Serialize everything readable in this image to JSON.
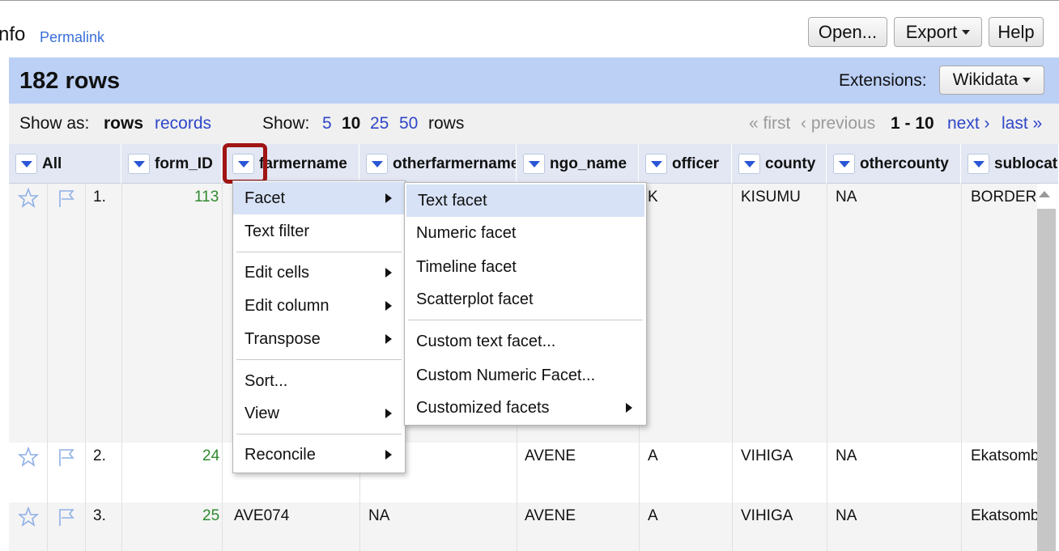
{
  "header": {
    "project_title_fragment": "nfo",
    "permalink": "Permalink",
    "open_label": "Open...",
    "export_label": "Export",
    "help_label": "Help"
  },
  "panel": {
    "row_count": "182 rows",
    "extensions_label": "Extensions:",
    "extensions_value": "Wikidata"
  },
  "controls": {
    "show_as_label": "Show as:",
    "rows_label": "rows",
    "records_label": "records",
    "show_label": "Show:",
    "page_sizes": [
      "5",
      "10",
      "25",
      "50"
    ],
    "selected_page_size": "10",
    "rows_suffix": "rows",
    "first": "« first",
    "previous": "‹ previous",
    "range": "1 - 10",
    "next": "next ›",
    "last": "last »"
  },
  "columns": [
    "All",
    "form_ID",
    "farmername",
    "otherfarmername",
    "ngo_name",
    "officer",
    "county",
    "othercounty",
    "sublocation"
  ],
  "rows": [
    {
      "index": "1.",
      "form_ID": "113",
      "farmername": "",
      "otherfarmername": "",
      "ngo_name": "",
      "officer": "K",
      "county": "KISUMU",
      "othercounty": "NA",
      "sublocation": "BORDER"
    },
    {
      "index": "2.",
      "form_ID": "24",
      "farmername": "",
      "otherfarmername": "",
      "ngo_name": "AVENE",
      "officer": "A",
      "county": "VIHIGA",
      "othercounty": "NA",
      "sublocation": "Ekatsombe"
    },
    {
      "index": "3.",
      "form_ID": "25",
      "farmername": "AVE074",
      "otherfarmername": "NA",
      "ngo_name": "AVENE",
      "officer": "A",
      "county": "VIHIGA",
      "othercounty": "NA",
      "sublocation": "Ekatsombe"
    }
  ],
  "column_menu": {
    "items": [
      "Facet",
      "Text filter",
      "Edit cells",
      "Edit column",
      "Transpose",
      "Sort...",
      "View",
      "Reconcile"
    ]
  },
  "facet_submenu": {
    "items": [
      "Text facet",
      "Numeric facet",
      "Timeline facet",
      "Scatterplot facet",
      "Custom text facet...",
      "Custom Numeric Facet...",
      "Customized facets"
    ]
  },
  "colors": {
    "panel_blue": "#bcd0f5",
    "link_blue": "#2f46c8",
    "highlight_red": "#a01414",
    "number_green": "#2f8a2f"
  }
}
